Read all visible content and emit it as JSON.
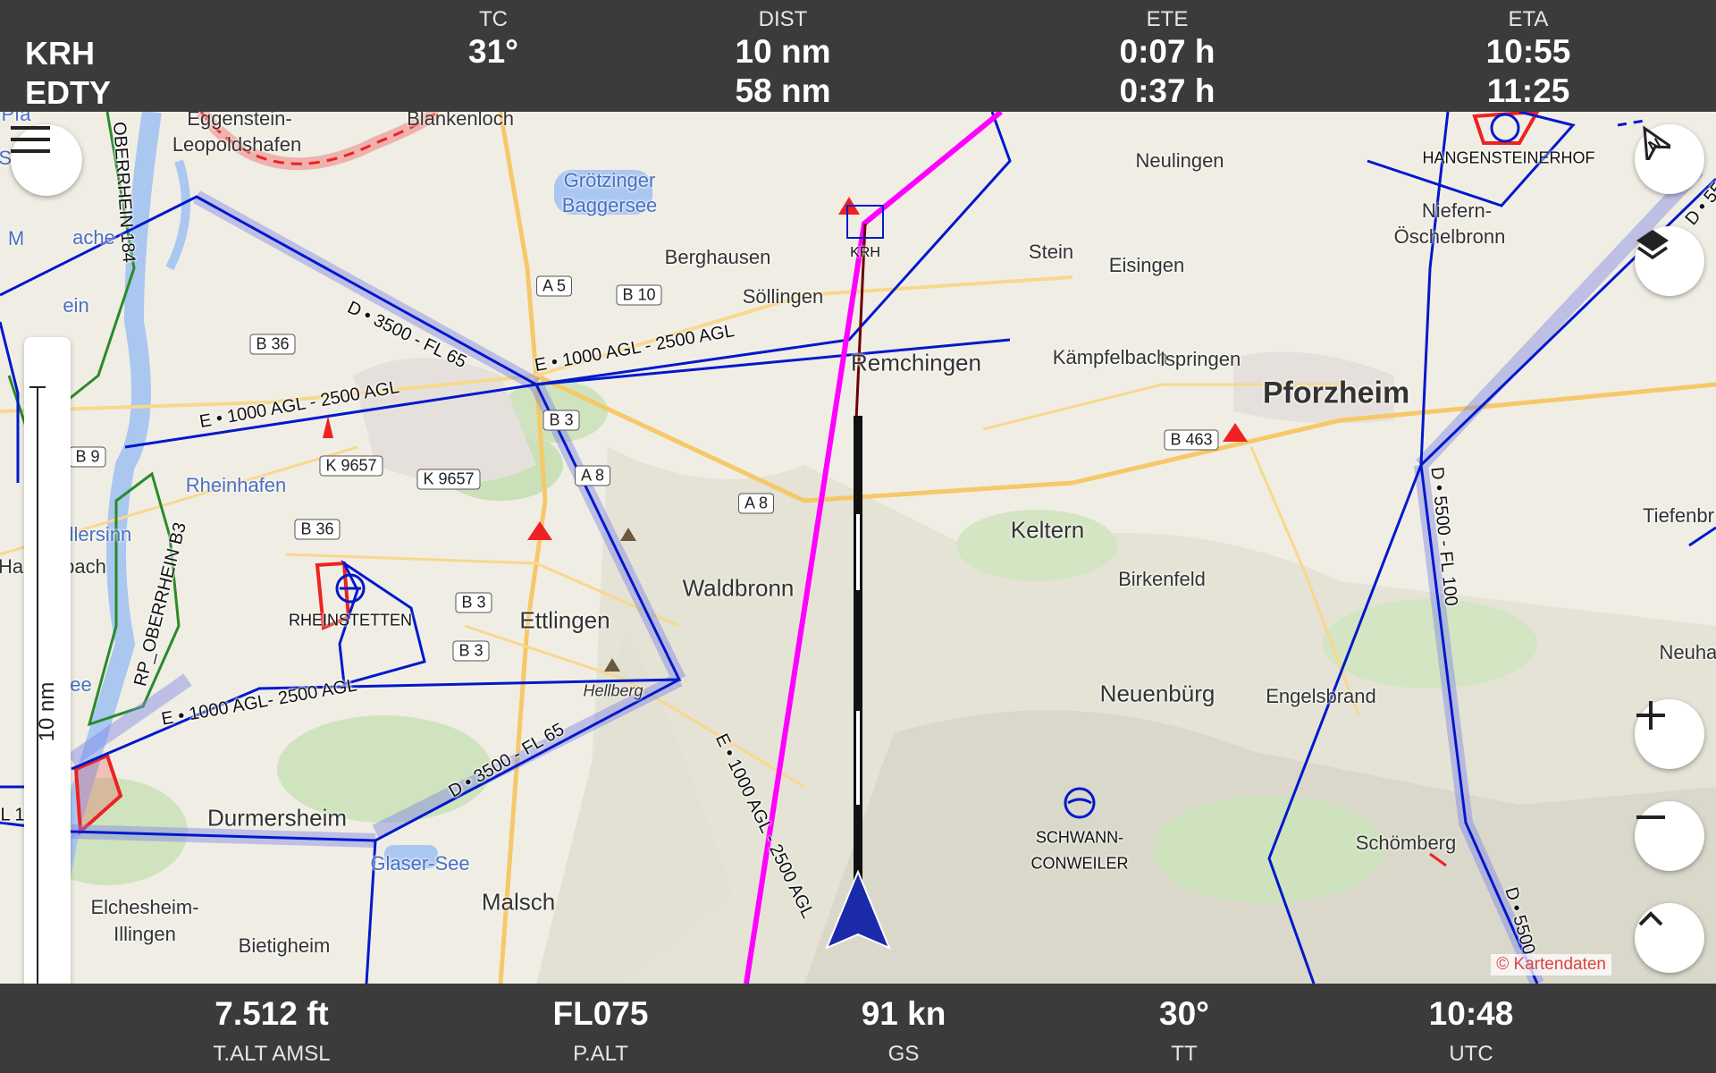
{
  "header": {
    "waypoints": [
      "KRH",
      "EDTY"
    ],
    "columns": [
      {
        "label": "TC",
        "values": [
          "31°"
        ]
      },
      {
        "label": "DIST",
        "values": [
          "10 nm",
          "58 nm"
        ]
      },
      {
        "label": "ETE",
        "values": [
          "0:07 h",
          "0:37 h"
        ]
      },
      {
        "label": "ETA",
        "values": [
          "10:55",
          "11:25"
        ]
      }
    ]
  },
  "footer": [
    {
      "value": "7.512 ft",
      "label": "T.ALT AMSL"
    },
    {
      "value": "FL075",
      "label": "P.ALT"
    },
    {
      "value": "91 kn",
      "label": "GS"
    },
    {
      "value": "30°",
      "label": "TT"
    },
    {
      "value": "10:48",
      "label": "UTC"
    }
  ],
  "scale": {
    "label": "10 nm"
  },
  "controls": {
    "menu": "menu-icon",
    "north": "compass-north-icon",
    "layers": "layers-icon",
    "zoom_in": "plus-icon",
    "zoom_out": "minus-icon",
    "up": "chevron-up-icon"
  },
  "attribution": "© Kartendaten",
  "map": {
    "places": [
      {
        "name": "Eggenstein-"
      },
      {
        "name": "Leopoldshafen"
      },
      {
        "name": "Blankenloch"
      },
      {
        "name": "Grötzinger"
      },
      {
        "name": "Baggersee"
      },
      {
        "name": "Berghausen"
      },
      {
        "name": "Söllingen"
      },
      {
        "name": "Remchingen"
      },
      {
        "name": "Neulingen"
      },
      {
        "name": "Stein"
      },
      {
        "name": "Eisingen"
      },
      {
        "name": "Kämpfelbach"
      },
      {
        "name": "Ispringen"
      },
      {
        "name": "Pforzheim"
      },
      {
        "name": "Niefern-"
      },
      {
        "name": "Öschelbronn"
      },
      {
        "name": "Rheinhafen"
      },
      {
        "name": "Keltern"
      },
      {
        "name": "Birkenfeld"
      },
      {
        "name": "Tiefenbr"
      },
      {
        "name": "Waldbronn"
      },
      {
        "name": "Ettlingen"
      },
      {
        "name": "Hellberg"
      },
      {
        "name": "Neuenbürg"
      },
      {
        "name": "Engelsbrand"
      },
      {
        "name": "Neuhau"
      },
      {
        "name": "Durmersheim"
      },
      {
        "name": "Glaser-See"
      },
      {
        "name": "Malsch"
      },
      {
        "name": "Elchesheim-"
      },
      {
        "name": "Illingen"
      },
      {
        "name": "Bietigheim"
      },
      {
        "name": "Schömberg"
      },
      {
        "name": "Ha"
      },
      {
        "name": "bach"
      },
      {
        "name": "illersinn"
      },
      {
        "name": "Pfa"
      },
      {
        "name": "See"
      },
      {
        "name": "M"
      },
      {
        "name": "ache"
      },
      {
        "name": "ein"
      },
      {
        "name": "see"
      }
    ],
    "roads": [
      "A 5",
      "B 10",
      "B 36",
      "B 3",
      "B 9",
      "K 9657",
      "K 9657",
      "A 8",
      "A 8",
      "B 36",
      "B 3",
      "B 3",
      "B 463"
    ],
    "airports": [
      "KRH",
      "RHEINSTETTEN",
      "SCHWANN-",
      "CONWEILER",
      "HANGENSTEINERHOF"
    ],
    "airspaces": [
      "D • 3500 - FL 65",
      "E • 1000 AGL - 2500 AGL",
      "E • 1000 AGL - 2500 AGL",
      "E • 1000 AGL- 2500 AGL",
      "D • 3500 - FL 65",
      "E • 1000 AGL - 2500 AGL",
      "D • 5500 - FL 100",
      "D • 5500",
      "D • 5500",
      "OBERRHEIN 184",
      "RP_OBERRHEIN B3",
      "L 1"
    ]
  },
  "colors": {
    "bar": "#3b3b3b",
    "route": "#ff00ff",
    "airspace": "#0018cc",
    "aircraft": "#1a2aa8"
  }
}
